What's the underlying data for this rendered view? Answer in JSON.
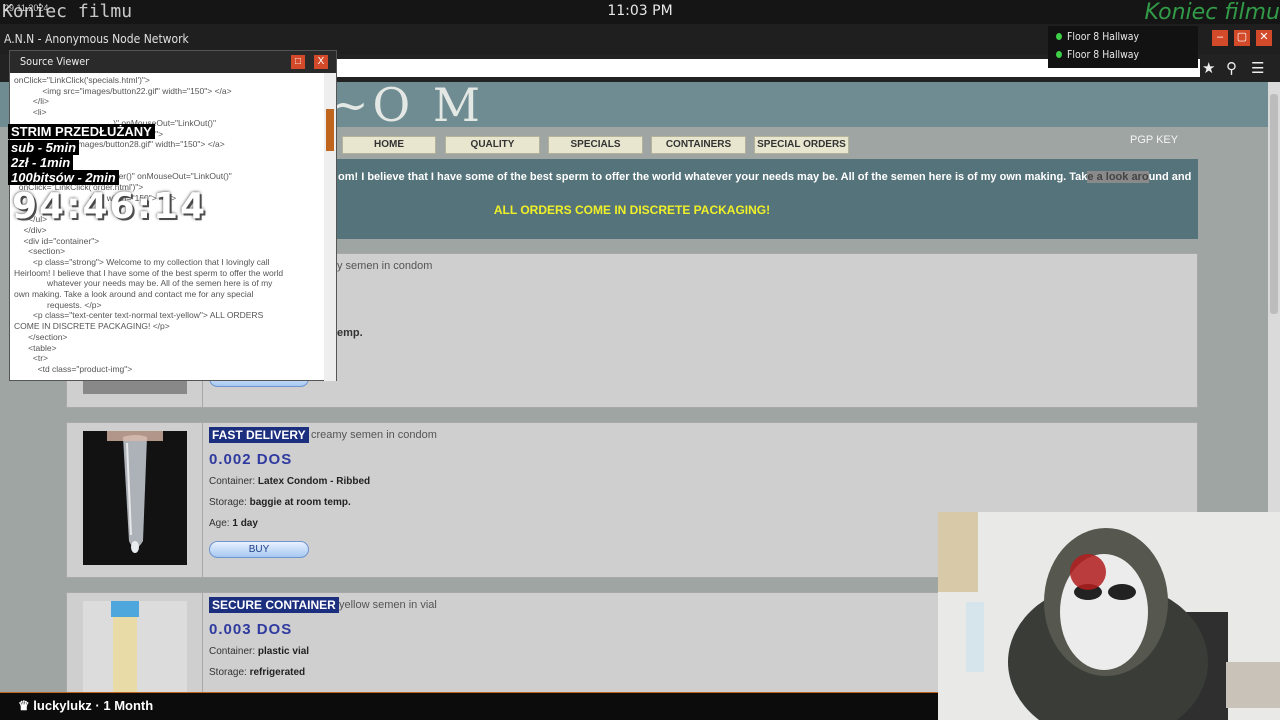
{
  "os": {
    "left_text": "29.11.2024",
    "overlay_ghost": "Koniec filmu",
    "clock": "11:03 PM",
    "overlay_green": "Koniec filmu"
  },
  "window": {
    "title": "A.N.N - Anonymous Node Network"
  },
  "rooms": [
    "Floor 8 Hallway",
    "Floor 8 Hallway"
  ],
  "site": {
    "logo": "~O M",
    "nav": [
      "HOME",
      "QUALITY",
      "SPECIALS",
      "CONTAINERS",
      "SPECIAL ORDERS"
    ],
    "pgp": "PGP KEY",
    "welcome_a": "om! I believe that I have some of the best sperm to offer the world whatever your needs may be. All of the semen here is of my own making. Tak",
    "welcome_hl": "e a look aro",
    "welcome_b": "und and",
    "orders": "ALL ORDERS COME IN DISCRETE PACKAGING!",
    "row1_sub": "y semen in condom",
    "row1_storage_tail": "emp.",
    "row1_buy": "BUY",
    "products": [
      {
        "tag": "FAST DELIVERY",
        "subtitle": "creamy semen in condom",
        "price": "0.002 DOS",
        "container_label": "Container:",
        "container": "Latex Condom - Ribbed",
        "storage_label": "Storage:",
        "storage": "baggie at room temp.",
        "age_label": "Age:",
        "age": "1 day",
        "buy": "BUY"
      },
      {
        "tag": "SECURE CONTAINER",
        "subtitle": "yellow semen in vial",
        "price": "0.003 DOS",
        "container_label": "Container:",
        "container": "plastic vial",
        "storage_label": "Storage:",
        "storage": "refrigerated"
      }
    ]
  },
  "source_viewer": {
    "title": "Source Viewer",
    "lines": [
      "onClick=\"LinkClick('specials.html')\">",
      "            <img src=\"images/button22.gif\" width=\"150\"> </a>",
      "        </li>",
      "        <li>",
      "                                          )\" onMouseOut=\"LinkOut()\"",
      "  onClick=\"LinkClick('containers.html')\">",
      "                  src=\"images/button28.gif\" width=\"150\"> </a>",
      "",
      "",
      "                              \"LinkHover()\" onMouseOut=\"LinkOut()\"",
      "  onClick=\"LinkClick('order.html')\">",
      "                                ght\" width=\"150\"> </a>",
      "",
      "      </ul>",
      "    </div>",
      "    <div id=\"container\">",
      "      <section>",
      "        <p class=\"strong\"> Welcome to my collection that I lovingly call",
      "Heirloom! I believe that I have some of the best sperm to offer the world",
      "              whatever your needs may be. All of the semen here is of my",
      "own making. Take a look around and contact me for any special",
      "              requests. </p>",
      "        <p class=\"text-center text-normal text-yellow\"> ALL ORDERS",
      "COME IN DISCRETE PACKAGING! </p>",
      "      </section>",
      "      <table>",
      "        <tr>",
      "          <td class=\"product-img\">"
    ]
  },
  "stream": {
    "title": "STRIM PRZEDŁUŻANY",
    "rules": [
      "sub - 5min",
      "2zł - 1min",
      "100bitsów - 2min"
    ],
    "timer": "94:46:14"
  },
  "bottom": {
    "user": "luckylukz",
    "months": "1 Month"
  }
}
